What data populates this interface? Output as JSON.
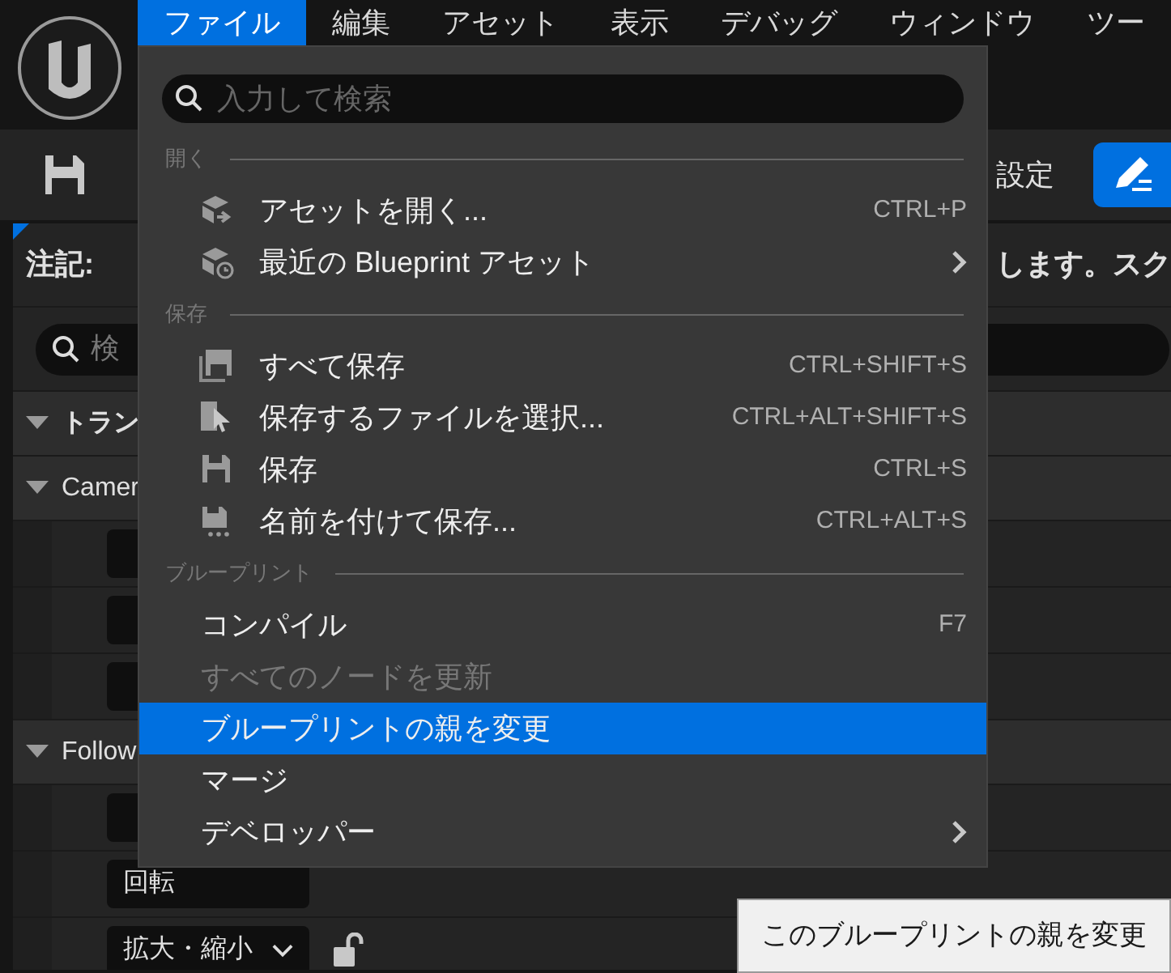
{
  "menu_bar": [
    {
      "label": "ファイル",
      "selected": true
    },
    {
      "label": "編集",
      "selected": false
    },
    {
      "label": "アセット",
      "selected": false
    },
    {
      "label": "表示",
      "selected": false
    },
    {
      "label": "デバッグ",
      "selected": false
    },
    {
      "label": "ウィンドウ",
      "selected": false
    },
    {
      "label": "ツー",
      "selected": false
    }
  ],
  "toolbar": {
    "settings_label": "設定"
  },
  "details": {
    "note_label": "注記:",
    "note_text": "します。スク",
    "search_placeholder": "検",
    "rows": [
      {
        "label": "トラン",
        "expanded": true
      },
      {
        "label": "Camer",
        "expanded": true,
        "children": [
          {
            "kind": "field"
          },
          {
            "kind": "field"
          },
          {
            "kind": "field"
          }
        ]
      },
      {
        "label": "Follow",
        "expanded": true,
        "children": [
          {
            "kind": "field"
          },
          {
            "kind": "field",
            "label": "回転"
          },
          {
            "kind": "field",
            "label": "拡大・縮小",
            "dropdown": true,
            "unlocked": true
          }
        ]
      }
    ]
  },
  "file_menu": {
    "search_placeholder": "入力して検索",
    "sections": [
      {
        "header": "開く",
        "items": [
          {
            "kind": "asset-open",
            "label": "アセットを開く...",
            "shortcut": "CTRL+P",
            "submenu": false,
            "disabled": false,
            "selected": false
          },
          {
            "kind": "asset-recent",
            "label": "最近の Blueprint アセット",
            "submenu": true,
            "disabled": false,
            "selected": false
          }
        ]
      },
      {
        "header": "保存",
        "items": [
          {
            "kind": "save-all",
            "label": "すべて保存",
            "shortcut": "CTRL+SHIFT+S",
            "submenu": false,
            "disabled": false,
            "selected": false
          },
          {
            "kind": "save-select",
            "label": "保存するファイルを選択...",
            "shortcut": "CTRL+ALT+SHIFT+S",
            "submenu": false,
            "disabled": false,
            "selected": false
          },
          {
            "kind": "save",
            "label": "保存",
            "shortcut": "CTRL+S",
            "submenu": false,
            "disabled": false,
            "selected": false
          },
          {
            "kind": "save-as",
            "label": "名前を付けて保存...",
            "shortcut": "CTRL+ALT+S",
            "submenu": false,
            "disabled": false,
            "selected": false
          }
        ]
      },
      {
        "header": "ブループリント",
        "items": [
          {
            "kind": "plain",
            "label": "コンパイル",
            "shortcut": "F7",
            "submenu": false,
            "disabled": false,
            "selected": false
          },
          {
            "kind": "plain",
            "label": "すべてのノードを更新",
            "submenu": false,
            "disabled": true,
            "selected": false
          },
          {
            "kind": "plain",
            "label": "ブループリントの親を変更",
            "submenu": false,
            "disabled": false,
            "selected": true
          },
          {
            "kind": "plain",
            "label": "マージ",
            "submenu": false,
            "disabled": false,
            "selected": false
          },
          {
            "kind": "plain",
            "label": "デベロッパー",
            "submenu": true,
            "disabled": false,
            "selected": false
          }
        ]
      }
    ]
  },
  "tooltip": {
    "text": "このブループリントの親を変更"
  }
}
